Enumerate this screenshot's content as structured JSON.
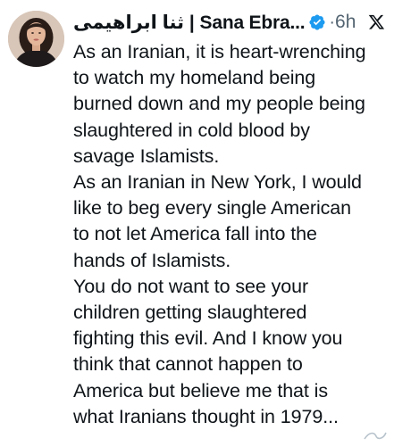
{
  "tweet": {
    "author": {
      "display_name": "ثنا ابراهیمی | Sana Ebra...",
      "avatar_icon": "profile-photo",
      "verified_icon": "verified-badge-icon",
      "verified_color": "#1d9bf0"
    },
    "separator": "·",
    "time": "6h",
    "platform_icon": "x-logo-icon",
    "paragraphs": [
      "As an Iranian, it is heart-wrenching\nto watch my homeland being\nburned down and my people being\nslaughtered in cold blood by\nsavage Islamists.",
      "As an Iranian in New York, I would\nlike to beg every single American\nto not let America fall into the\nhands of Islamists.",
      "You do not want to see your\nchildren getting slaughtered\nfighting this evil. And I know you\nthink that cannot happen to\nAmerica but believe me that is\nwhat Iranians thought in 1979..."
    ]
  }
}
